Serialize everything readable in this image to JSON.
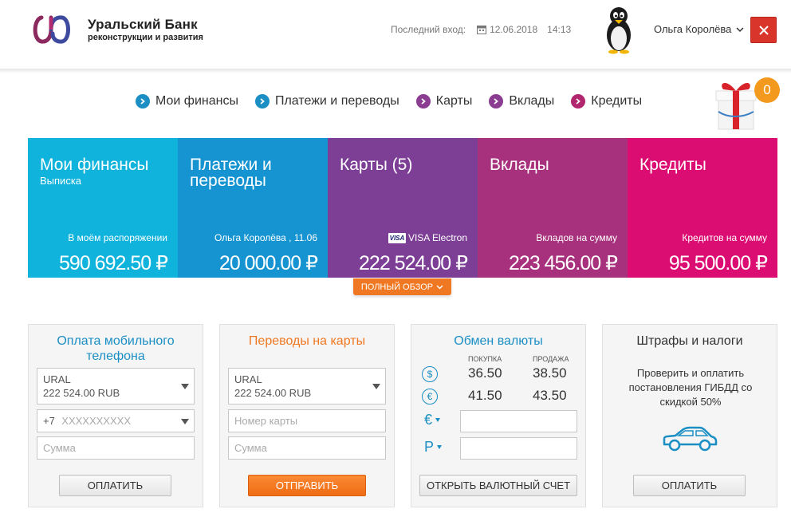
{
  "header": {
    "bank_name_line1": "Уральский Банк",
    "bank_name_line2": "реконструкции и развития",
    "last_login_label": "Последний вход:",
    "last_login_date": "12.06.2018",
    "last_login_time": "14:13",
    "user_name": "Ольга Королёва"
  },
  "nav": {
    "items": [
      {
        "label": "Мои финансы",
        "color": "#1b8fc4"
      },
      {
        "label": "Платежи и переводы",
        "color": "#1b8fc4"
      },
      {
        "label": "Карты",
        "color": "#8b3d91"
      },
      {
        "label": "Вклады",
        "color": "#8b3d91"
      },
      {
        "label": "Кредиты",
        "color": "#b1266f"
      }
    ],
    "gift_count": "0"
  },
  "tiles": [
    {
      "title": "Мои финансы",
      "subtitle": "Выписка",
      "caption": "В моём распоряжении",
      "amount": "590 692.50 ₽",
      "color": "#0fb3dc"
    },
    {
      "title": "Платежи и переводы",
      "subtitle": "",
      "caption": "Ольга Королёва , 11.06",
      "amount": "20 000.00 ₽",
      "color": "#1594d1"
    },
    {
      "title": "Карты (5)",
      "subtitle": "",
      "caption": "VISA Electron",
      "amount": "222 524.00 ₽",
      "color": "#7c3f95"
    },
    {
      "title": "Вклады",
      "subtitle": "",
      "caption": "Вкладов на сумму",
      "amount": "223 456.00 ₽",
      "color": "#a7317d"
    },
    {
      "title": "Кредиты",
      "subtitle": "",
      "caption": "Кредитов на сумму",
      "amount": "95 500.00 ₽",
      "color": "#dc0d72"
    }
  ],
  "overview_button": "ПОЛНЫЙ ОБЗОР",
  "mobile": {
    "title": "Оплата мобильного телефона",
    "account_name": "URAL",
    "account_balance": "222 524.00 RUB",
    "phone_prefix": "+7",
    "phone_placeholder": "XXXXXXXXXX",
    "amount_placeholder": "Сумма",
    "button": "ОПЛАТИТЬ"
  },
  "card_transfer": {
    "title": "Переводы на карты",
    "account_name": "URAL",
    "account_balance": "222 524.00 RUB",
    "card_placeholder": "Номер карты",
    "amount_placeholder": "Сумма",
    "button": "ОТПРАВИТЬ"
  },
  "exchange": {
    "title": "Обмен валюты",
    "buy_label": "ПОКУПКА",
    "sell_label": "ПРОДАЖА",
    "rates": [
      {
        "symbol": "$",
        "buy": "36.50",
        "sell": "38.50"
      },
      {
        "symbol": "€",
        "buy": "41.50",
        "sell": "43.50"
      }
    ],
    "from_currency": "€",
    "to_currency": "Р",
    "button": "ОТКРЫТЬ ВАЛЮТНЫЙ СЧЕТ"
  },
  "fines": {
    "title": "Штрафы и налоги",
    "text": "Проверить и оплатить постановления ГИБДД со скидкой 50%",
    "button": "ОПЛАТИТЬ"
  }
}
